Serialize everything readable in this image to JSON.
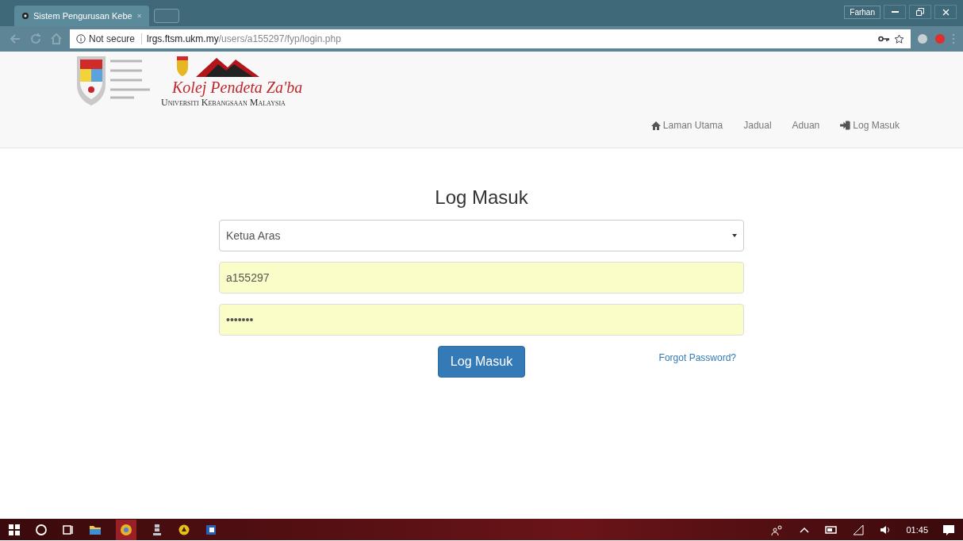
{
  "browser": {
    "tabs": [
      {
        "title": "Sistem Pengurusan Kebe",
        "selected": true
      }
    ],
    "profile": "Farhan",
    "address_bar": {
      "security": "Not secure",
      "host": "lrgs.ftsm.ukm.my",
      "path": "/users/a155297/fyp/login.php"
    }
  },
  "header": {
    "logo_title": "Kolej Pendeta Za'ba",
    "logo_subtitle": "Universiti Kebangsaan Malaysia",
    "nav": [
      {
        "label": "Laman Utama",
        "kind": "home"
      },
      {
        "label": "Jadual",
        "kind": "plain"
      },
      {
        "label": "Aduan",
        "kind": "plain"
      },
      {
        "label": "Log Masuk",
        "kind": "login"
      }
    ]
  },
  "login": {
    "title": "Log Masuk",
    "role": "Ketua Aras",
    "username": "a155297",
    "password": "•••••••",
    "submit": "Log Masuk",
    "forgot": "Forgot Password?"
  },
  "taskbar": {
    "clock": "01:45"
  }
}
